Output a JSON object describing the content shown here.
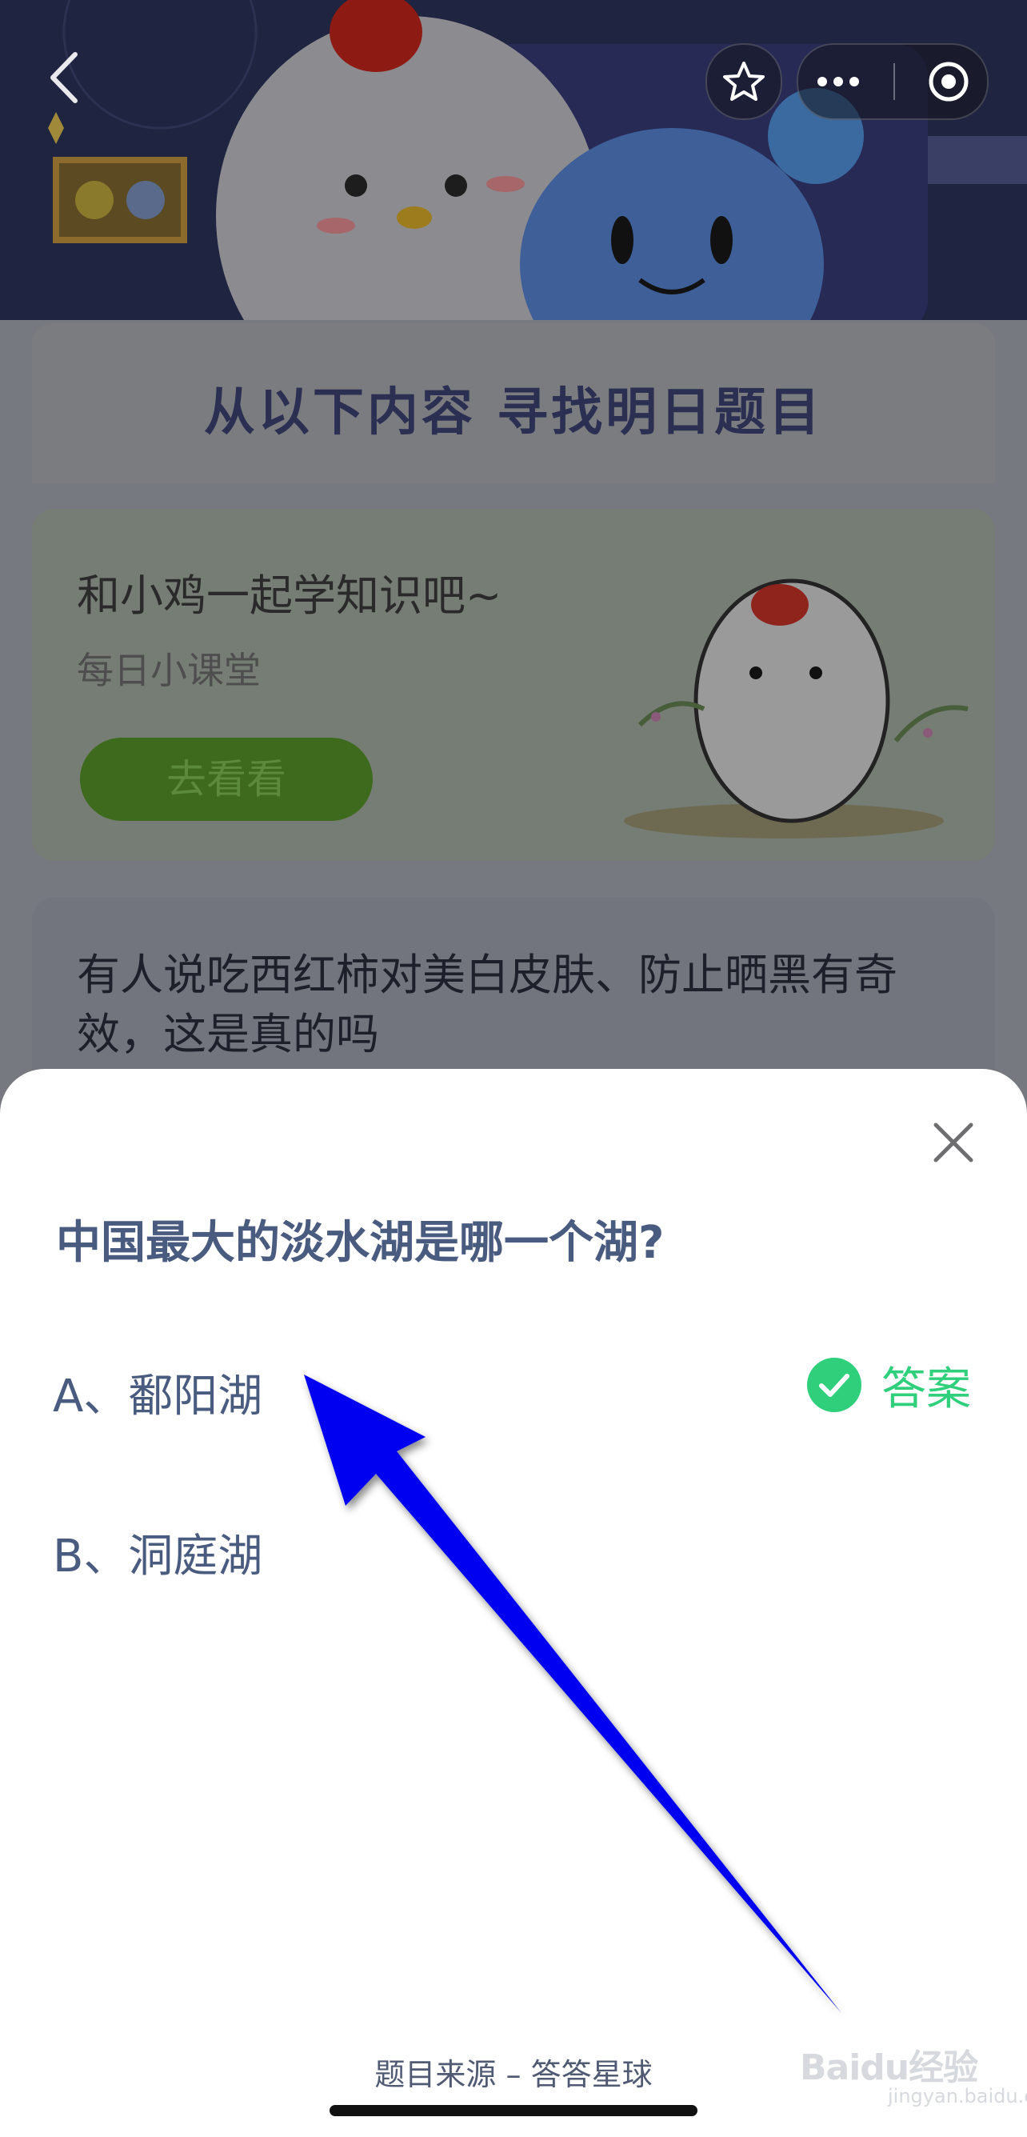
{
  "background": {
    "board_title": "从以下内容  寻找明日题目",
    "lesson_card": {
      "title": "和小鸡一起学知识吧~",
      "subtitle": "每日小课堂",
      "button_label": "去看看"
    },
    "question_card": {
      "text": "有人说吃西红柿对美白皮肤、防止晒黑有奇效，这是真的吗"
    }
  },
  "nav": {
    "back_icon": "chevron-left-icon",
    "favorite_icon": "star-icon",
    "more_icon": "more-dots-icon",
    "close_mini_icon": "target-circle-icon"
  },
  "sheet": {
    "question": "中国最大的淡水湖是哪一个湖?",
    "options": [
      {
        "label": "A、鄱阳湖",
        "is_answer": true
      },
      {
        "label": "B、洞庭湖",
        "is_answer": false
      }
    ],
    "answer_label": "答案",
    "source": "题目来源 – 答答星球"
  },
  "watermark": {
    "brand": "Baidu经验",
    "domain": "jingyan.baidu.com"
  },
  "colors": {
    "text_primary": "#4a5b80",
    "answer_green": "#2fcf7c",
    "arrow_blue": "#0000f0"
  }
}
